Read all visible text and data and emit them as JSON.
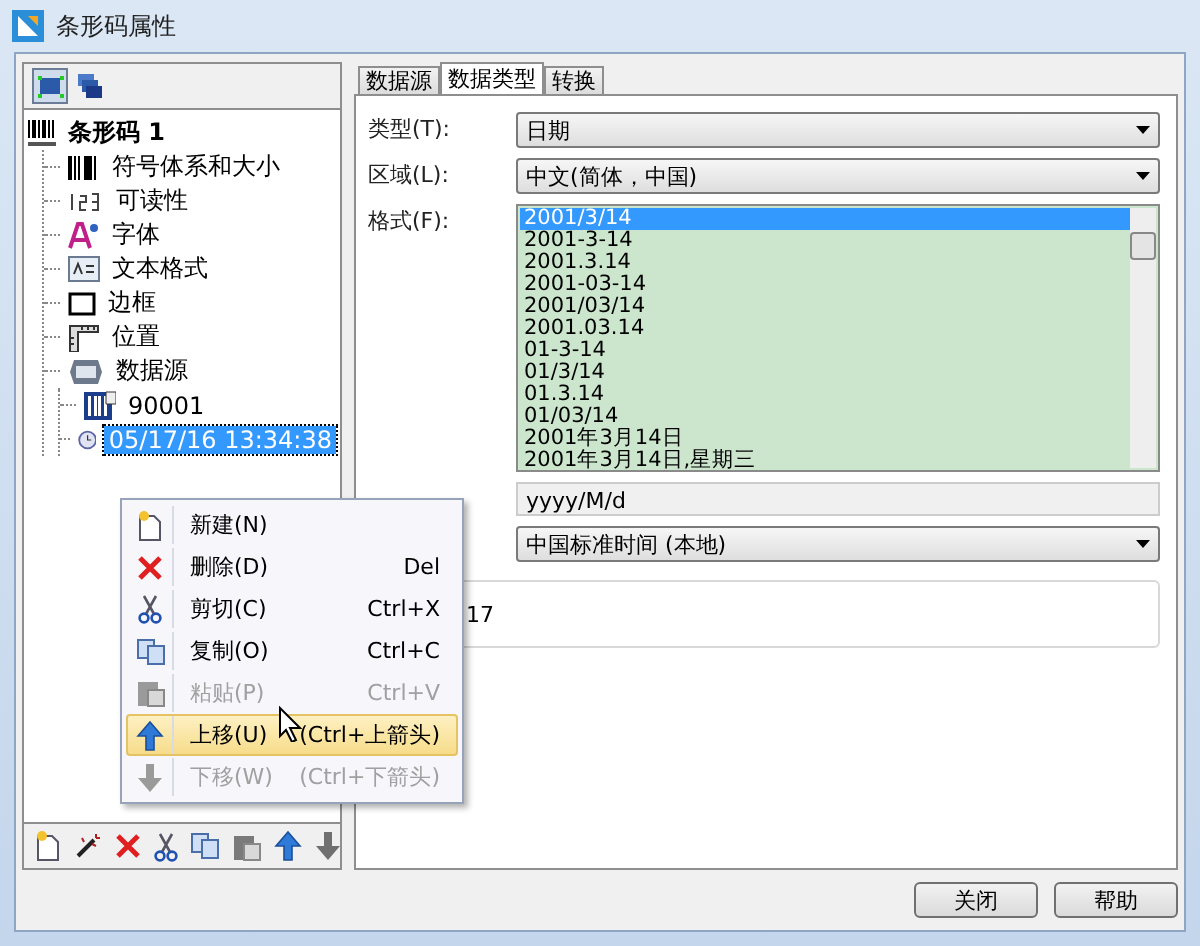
{
  "window": {
    "title": "条形码属性"
  },
  "tree": {
    "label": "条形码 1",
    "kind": "barcode",
    "selected": false,
    "children": [
      {
        "label": "符号体系和大小",
        "kind": "bars",
        "selected": false
      },
      {
        "label": "可读性",
        "kind": "digits",
        "selected": false
      },
      {
        "label": "字体",
        "kind": "font",
        "selected": false
      },
      {
        "label": "文本格式",
        "kind": "textbox",
        "selected": false
      },
      {
        "label": "边框",
        "kind": "border",
        "selected": false
      },
      {
        "label": "位置",
        "kind": "ruler",
        "selected": false
      },
      {
        "label": "数据源",
        "kind": "data",
        "selected": false,
        "children": [
          {
            "label": "90001",
            "kind": "file",
            "selected": false
          },
          {
            "label": "05/17/16 13:34:38",
            "kind": "clock",
            "selected": true
          }
        ]
      }
    ]
  },
  "tabs": [
    {
      "label": "数据源",
      "selected": false
    },
    {
      "label": "数据类型",
      "selected": true
    },
    {
      "label": "转换",
      "selected": false
    }
  ],
  "type_field": {
    "label": "类型(T):",
    "value": "日期"
  },
  "region_field": {
    "label": "区域(L):",
    "value": "中文(简体，中国)"
  },
  "format_list": {
    "label": "格式(F):",
    "items": [
      {
        "text": "2001/3/14",
        "selected": true
      },
      {
        "text": "2001-3-14",
        "selected": false
      },
      {
        "text": "2001.3.14",
        "selected": false
      },
      {
        "text": "2001-03-14",
        "selected": false
      },
      {
        "text": "2001/03/14",
        "selected": false
      },
      {
        "text": "2001.03.14",
        "selected": false
      },
      {
        "text": "01-3-14",
        "selected": false
      },
      {
        "text": "01/3/14",
        "selected": false
      },
      {
        "text": "01.3.14",
        "selected": false
      },
      {
        "text": "01/03/14",
        "selected": false
      },
      {
        "text": "2001年3月14日",
        "selected": false
      },
      {
        "text": "2001年3月14日,星期三",
        "selected": false
      }
    ]
  },
  "pattern_field": {
    "value": "yyyy/M/d"
  },
  "timezone_field": {
    "value": "中国标准时间 (本地)"
  },
  "preview": {
    "text": "17"
  },
  "context_menu": [
    {
      "label": "新建(N)",
      "kind": "new",
      "disabled": false,
      "selected": false
    },
    {
      "label": "删除(D)",
      "shortcut": "Del",
      "kind": "delete",
      "disabled": false,
      "selected": false
    },
    {
      "label": "剪切(C)",
      "shortcut": "Ctrl+X",
      "kind": "cut",
      "disabled": false,
      "selected": false
    },
    {
      "label": "复制(O)",
      "shortcut": "Ctrl+C",
      "kind": "copy",
      "disabled": false,
      "selected": false
    },
    {
      "label": "粘贴(P)",
      "shortcut": "Ctrl+V",
      "kind": "paste",
      "disabled": true,
      "selected": false
    },
    {
      "label": "上移(U)",
      "shortcut": "(Ctrl+上箭头)",
      "kind": "up",
      "disabled": false,
      "selected": true
    },
    {
      "label": "下移(W)",
      "shortcut": "(Ctrl+下箭头)",
      "kind": "down",
      "disabled": true,
      "selected": false
    }
  ],
  "toolbar": [
    {
      "kind": "new"
    },
    {
      "kind": "wand"
    },
    {
      "kind": "delete"
    },
    {
      "kind": "cut"
    },
    {
      "kind": "copy"
    },
    {
      "kind": "paste"
    },
    {
      "kind": "up"
    },
    {
      "kind": "down"
    }
  ],
  "buttons": [
    "关闭",
    "帮助"
  ]
}
